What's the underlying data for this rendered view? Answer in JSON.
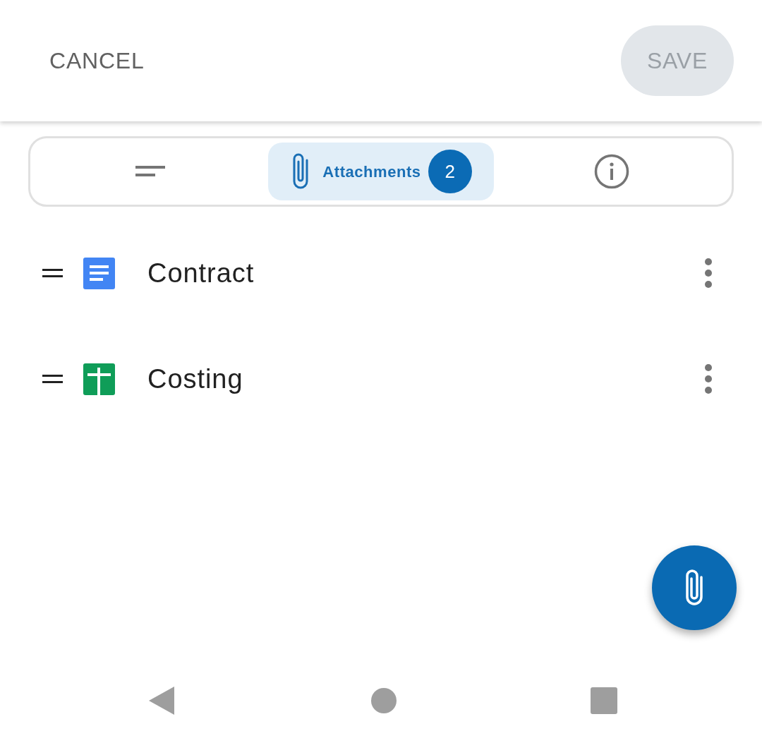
{
  "top_bar": {
    "cancel": "CANCEL",
    "save": {
      "label": "SAVE",
      "disabled": true
    }
  },
  "tabs": [
    {
      "kind": "description",
      "selected": false
    },
    {
      "kind": "attachments",
      "label": "Attachments",
      "badge": "2",
      "selected": true
    },
    {
      "kind": "info",
      "selected": false
    }
  ],
  "attachments": [
    {
      "name": "Contract",
      "kind": "document"
    },
    {
      "name": "Costing",
      "kind": "spreadsheet"
    }
  ]
}
